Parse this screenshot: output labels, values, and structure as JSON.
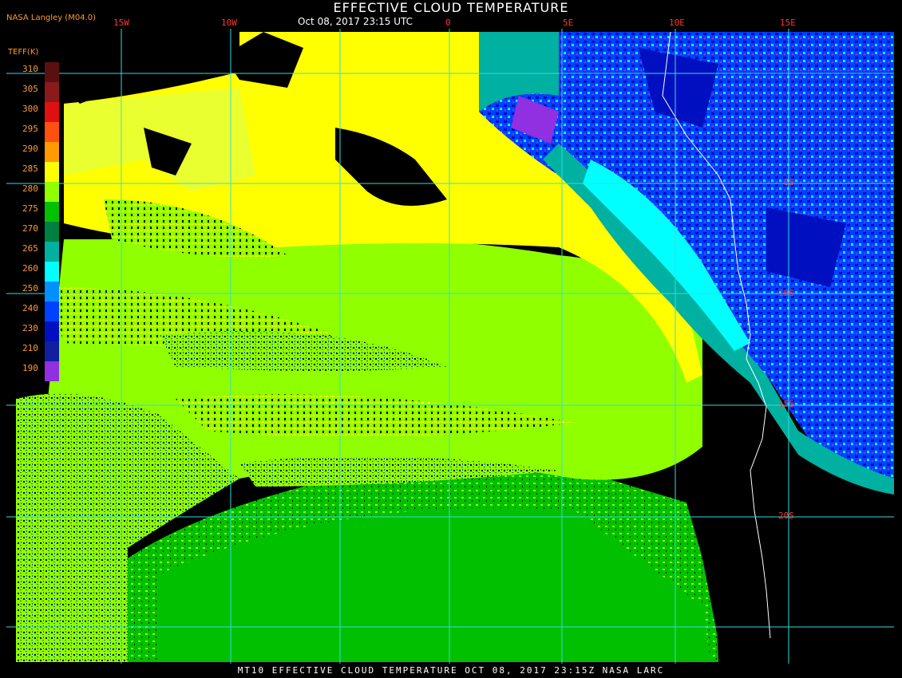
{
  "title": "EFFECTIVE CLOUD TEMPERATURE",
  "subtitle": "Oct 08, 2017 23:15 UTC",
  "producer": "NASA Langley (M04.0)",
  "legend": {
    "title": "TEFF(K)",
    "entries": [
      {
        "label": "310",
        "color": "#5a1010"
      },
      {
        "label": "305",
        "color": "#8b1a1a"
      },
      {
        "label": "300",
        "color": "#e01010"
      },
      {
        "label": "295",
        "color": "#ff5010"
      },
      {
        "label": "290",
        "color": "#ff9a00"
      },
      {
        "label": "285",
        "color": "#ffff00"
      },
      {
        "label": "280",
        "color": "#90ff00"
      },
      {
        "label": "275",
        "color": "#00c000"
      },
      {
        "label": "270",
        "color": "#008040"
      },
      {
        "label": "265",
        "color": "#00b0a0"
      },
      {
        "label": "260",
        "color": "#00ffff"
      },
      {
        "label": "250",
        "color": "#0090ff"
      },
      {
        "label": "240",
        "color": "#0040ff"
      },
      {
        "label": "230",
        "color": "#0010c0"
      },
      {
        "label": "210",
        "color": "#1020a0"
      },
      {
        "label": "190",
        "color": "#9030e0"
      }
    ]
  },
  "longitudes": [
    "15W",
    "10W",
    "0",
    "5E",
    "10E",
    "15E"
  ],
  "latitudes": [
    "5S",
    "10S",
    "15S",
    "20S"
  ],
  "footer": "MT10  EFFECTIVE CLOUD TEMPERATURE  OCT 08, 2017 23:15Z  NASA LARC",
  "colors": {
    "background": "#000000",
    "grid": "#33dddd",
    "coast": "#ffffff",
    "label_text": "#ff9933",
    "grid_label": "#ff3333"
  }
}
